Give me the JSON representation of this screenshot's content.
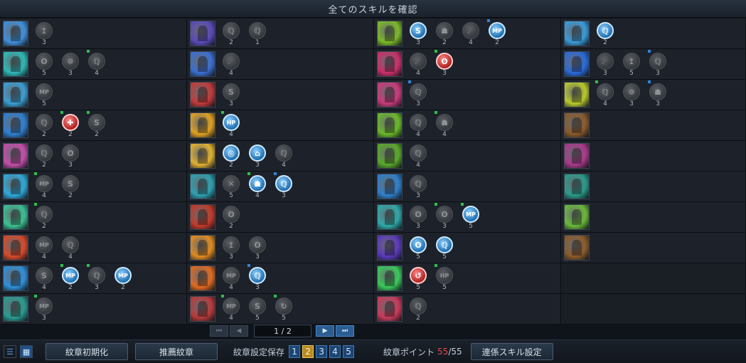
{
  "title": "全てのスキルを確認",
  "columns": [
    [
      {
        "color": "#3f8fd9",
        "crests": [
          {
            "type": "gray",
            "glyph": "↥",
            "num": "3",
            "flag": ""
          }
        ]
      },
      {
        "color": "#2fb8b4",
        "crests": [
          {
            "type": "gray",
            "glyph": "ʘ",
            "num": "5",
            "flag": ""
          },
          {
            "type": "gray",
            "glyph": "☸",
            "num": "3",
            "flag": ""
          },
          {
            "type": "gray",
            "glyph": "ℚ",
            "num": "4",
            "flag": "green"
          }
        ]
      },
      {
        "color": "#3b9ed3",
        "crests": [
          {
            "type": "gray",
            "glyph": "MP",
            "num": "5",
            "flag": ""
          }
        ]
      },
      {
        "color": "#2f7fd0",
        "crests": [
          {
            "type": "gray",
            "glyph": "ℚ",
            "num": "2",
            "flag": ""
          },
          {
            "type": "red",
            "glyph": "✚",
            "num": "2",
            "flag": "green"
          },
          {
            "type": "gray",
            "glyph": "S",
            "num": "2",
            "flag": "green"
          }
        ]
      },
      {
        "color": "#c24ea8",
        "crests": [
          {
            "type": "gray",
            "glyph": "ℚ",
            "num": "2",
            "flag": ""
          },
          {
            "type": "gray",
            "glyph": "ʘ",
            "num": "3",
            "flag": ""
          }
        ]
      },
      {
        "color": "#2fa8d8",
        "crests": [
          {
            "type": "gray",
            "glyph": "MP",
            "num": "4",
            "flag": "green"
          },
          {
            "type": "gray",
            "glyph": "S",
            "num": "2",
            "flag": ""
          }
        ]
      },
      {
        "color": "#3bbf90",
        "crests": [
          {
            "type": "gray",
            "glyph": "ℚ",
            "num": "2",
            "flag": "green"
          }
        ]
      },
      {
        "color": "#d44a2a",
        "crests": [
          {
            "type": "gray",
            "glyph": "MP",
            "num": "4",
            "flag": ""
          },
          {
            "type": "gray",
            "glyph": "ℚ",
            "num": "4",
            "flag": ""
          }
        ]
      },
      {
        "color": "#2f8fd8",
        "crests": [
          {
            "type": "gray",
            "glyph": "S",
            "num": "4",
            "flag": ""
          },
          {
            "type": "blue",
            "glyph": "MP",
            "num": "2",
            "flag": "green"
          },
          {
            "type": "gray",
            "glyph": "ℚ",
            "num": "3",
            "flag": "green"
          },
          {
            "type": "blue",
            "glyph": "MP",
            "num": "2",
            "flag": ""
          }
        ]
      },
      {
        "color": "#2a9a8f",
        "crests": [
          {
            "type": "gray",
            "glyph": "MP",
            "num": "3",
            "flag": "green"
          }
        ]
      }
    ],
    [
      {
        "color": "#5a4ab8",
        "crests": [
          {
            "type": "gray",
            "glyph": "ℚ",
            "num": "2",
            "flag": ""
          },
          {
            "type": "gray",
            "glyph": "ℚ",
            "num": "1",
            "flag": ""
          }
        ]
      },
      {
        "color": "#3b6fd0",
        "crests": [
          {
            "type": "gray",
            "glyph": "☄",
            "num": "4",
            "flag": ""
          }
        ]
      },
      {
        "color": "#c23a3a",
        "crests": [
          {
            "type": "gray",
            "glyph": "S",
            "num": "3",
            "flag": ""
          }
        ]
      },
      {
        "color": "#e0a020",
        "crests": [
          {
            "type": "blue",
            "glyph": "HP",
            "num": "4",
            "flag": "green"
          }
        ]
      },
      {
        "color": "#e0b030",
        "crests": [
          {
            "type": "blue",
            "glyph": "◎",
            "num": "2",
            "flag": ""
          },
          {
            "type": "blue",
            "glyph": "⌂",
            "num": "3",
            "flag": ""
          },
          {
            "type": "gray",
            "glyph": "ℚ",
            "num": "4",
            "flag": ""
          }
        ]
      },
      {
        "color": "#2f9fb0",
        "crests": [
          {
            "type": "gray",
            "glyph": "✕",
            "num": "5",
            "flag": ""
          },
          {
            "type": "blue",
            "glyph": "☗",
            "num": "4",
            "flag": "green"
          },
          {
            "type": "blue",
            "glyph": "ℚ",
            "num": "3",
            "flag": "blue"
          }
        ]
      },
      {
        "color": "#c23a2a",
        "crests": [
          {
            "type": "gray",
            "glyph": "ʘ",
            "num": "2",
            "flag": ""
          }
        ]
      },
      {
        "color": "#e08a20",
        "crests": [
          {
            "type": "gray",
            "glyph": "↥",
            "num": "3",
            "flag": ""
          },
          {
            "type": "gray",
            "glyph": "ʘ",
            "num": "3",
            "flag": ""
          }
        ]
      },
      {
        "color": "#e06a20",
        "crests": [
          {
            "type": "gray",
            "glyph": "MP",
            "num": "4",
            "flag": ""
          },
          {
            "type": "blue",
            "glyph": "ℚ",
            "num": "3",
            "flag": "blue"
          }
        ]
      },
      {
        "color": "#b83a3a",
        "crests": [
          {
            "type": "gray",
            "glyph": "MP",
            "num": "4",
            "flag": "green"
          },
          {
            "type": "gray",
            "glyph": "S",
            "num": "5",
            "flag": ""
          },
          {
            "type": "gray",
            "glyph": "↻",
            "num": "5",
            "flag": "green"
          }
        ]
      }
    ],
    [
      {
        "color": "#7cb82a",
        "crests": [
          {
            "type": "blue",
            "glyph": "S",
            "num": "3",
            "flag": ""
          },
          {
            "type": "gray",
            "glyph": "☗",
            "num": "2",
            "flag": ""
          },
          {
            "type": "gray",
            "glyph": "☄",
            "num": "4",
            "flag": ""
          },
          {
            "type": "blue",
            "glyph": "MP",
            "num": "2",
            "flag": "blue"
          }
        ]
      },
      {
        "color": "#c8306a",
        "crests": [
          {
            "type": "gray",
            "glyph": "☄",
            "num": "4",
            "flag": ""
          },
          {
            "type": "red",
            "glyph": "ʘ",
            "num": "3",
            "flag": "green"
          }
        ]
      },
      {
        "color": "#c83a7a",
        "crests": [
          {
            "type": "gray",
            "glyph": "ℚ",
            "num": "3",
            "flag": "blue"
          }
        ]
      },
      {
        "color": "#6ab82a",
        "crests": [
          {
            "type": "gray",
            "glyph": "ℚ",
            "num": "4",
            "flag": ""
          },
          {
            "type": "gray",
            "glyph": "☗",
            "num": "4",
            "flag": "green"
          }
        ]
      },
      {
        "color": "#5aa82a",
        "crests": [
          {
            "type": "gray",
            "glyph": "ℚ",
            "num": "4",
            "flag": ""
          }
        ]
      },
      {
        "color": "#2f7fc8",
        "crests": [
          {
            "type": "gray",
            "glyph": "ℚ",
            "num": "3",
            "flag": ""
          }
        ]
      },
      {
        "color": "#2fa8a8",
        "crests": [
          {
            "type": "gray",
            "glyph": "ʘ",
            "num": "3",
            "flag": ""
          },
          {
            "type": "gray",
            "glyph": "ʘ",
            "num": "3",
            "flag": "green"
          },
          {
            "type": "blue",
            "glyph": "MP",
            "num": "5",
            "flag": "green"
          }
        ]
      },
      {
        "color": "#5a3ab8",
        "crests": [
          {
            "type": "blue",
            "glyph": "ʘ",
            "num": "5",
            "flag": ""
          },
          {
            "type": "blue",
            "glyph": "ℚ",
            "num": "5",
            "flag": ""
          }
        ]
      },
      {
        "color": "#3ac85a",
        "crests": [
          {
            "type": "red",
            "glyph": "↺",
            "num": "5",
            "flag": ""
          },
          {
            "type": "gray",
            "glyph": "HP",
            "num": "5",
            "flag": "green"
          }
        ]
      },
      {
        "color": "#c83a5a",
        "crests": [
          {
            "type": "gray",
            "glyph": "ℚ",
            "num": "2",
            "flag": ""
          }
        ]
      }
    ],
    [
      {
        "color": "#3a9ad8",
        "crests": [
          {
            "type": "blue",
            "glyph": "ℚ",
            "num": "2",
            "flag": ""
          }
        ]
      },
      {
        "color": "#2a6ad8",
        "crests": [
          {
            "type": "gray",
            "glyph": "☄",
            "num": "3",
            "flag": ""
          },
          {
            "type": "gray",
            "glyph": "↥",
            "num": "5",
            "flag": ""
          },
          {
            "type": "gray",
            "glyph": "ℚ",
            "num": "3",
            "flag": "blue"
          }
        ]
      },
      {
        "color": "#b8c82a",
        "crests": [
          {
            "type": "gray",
            "glyph": "ℚ",
            "num": "4",
            "flag": "green"
          },
          {
            "type": "gray",
            "glyph": "☸",
            "num": "3",
            "flag": ""
          },
          {
            "type": "gray",
            "glyph": "☗",
            "num": "3",
            "flag": "blue"
          }
        ]
      },
      {
        "color": "#8a5a2a",
        "crests": []
      },
      {
        "color": "#a83a8a",
        "crests": []
      },
      {
        "color": "#2a9a8a",
        "crests": []
      },
      {
        "color": "#6ab83a",
        "crests": []
      },
      {
        "color": "#8a5a2a",
        "crests": []
      },
      {
        "color": "",
        "crests": []
      },
      {
        "color": "",
        "crests": []
      }
    ]
  ],
  "pager": {
    "page": "1 / 2"
  },
  "bottom": {
    "reset_label": "紋章初期化",
    "recommend_label": "推薦紋章",
    "save_label": "紋章設定保存",
    "slots": [
      "1",
      "2",
      "3",
      "4",
      "5"
    ],
    "active_slot": 1,
    "points_label": "紋章ポイント",
    "points_current": "55",
    "points_max": "/55",
    "chain_label": "連係スキル設定"
  }
}
